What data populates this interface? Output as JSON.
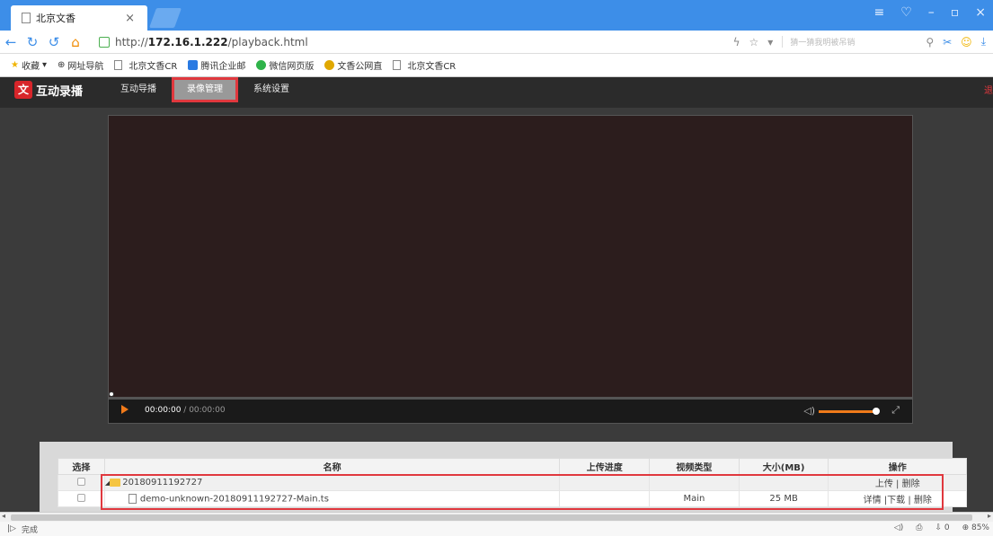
{
  "browser": {
    "tab_title": "北京文香",
    "tab_close": "×",
    "url_proto": "http://",
    "url_host": "172.16.1.222",
    "url_path": "/playback.html",
    "search_placeholder": "猜一猜我明被吊销",
    "bookmarks": [
      "收藏",
      "网址导航",
      "北京文香CR",
      "腾讯企业邮",
      "微信网页版",
      "文香公网直",
      "北京文香CR"
    ],
    "status_text": "完成",
    "zoom": "85%",
    "download_count": "0"
  },
  "app": {
    "logo_mark": "文香",
    "logo_text": "互动录播",
    "nav": [
      "互动导播",
      "录像管理",
      "系统设置"
    ],
    "active_nav": "录像管理"
  },
  "player": {
    "current_time": "00:00:00",
    "separator": " / ",
    "total_time": "00:00:00",
    "volume_percent": 100,
    "progress_percent": 0
  },
  "table": {
    "headers": {
      "select": "选择",
      "name": "名称",
      "progress": "上传进度",
      "type": "视频类型",
      "size": "大小(MB)",
      "ops": "操作"
    },
    "rows": [
      {
        "name": "20180911192727",
        "progress": "",
        "type": "",
        "size": "",
        "ops": "上传 | 删除"
      },
      {
        "name": "demo-unknown-20180911192727-Main.ts",
        "progress": "",
        "type": "Main",
        "size": "25 MB",
        "ops": "详情 |下载 | 删除"
      }
    ]
  },
  "colors": {
    "browser_blue": "#3d8ee8",
    "highlight_red": "#e0383e",
    "player_orange": "#f07a1a"
  }
}
